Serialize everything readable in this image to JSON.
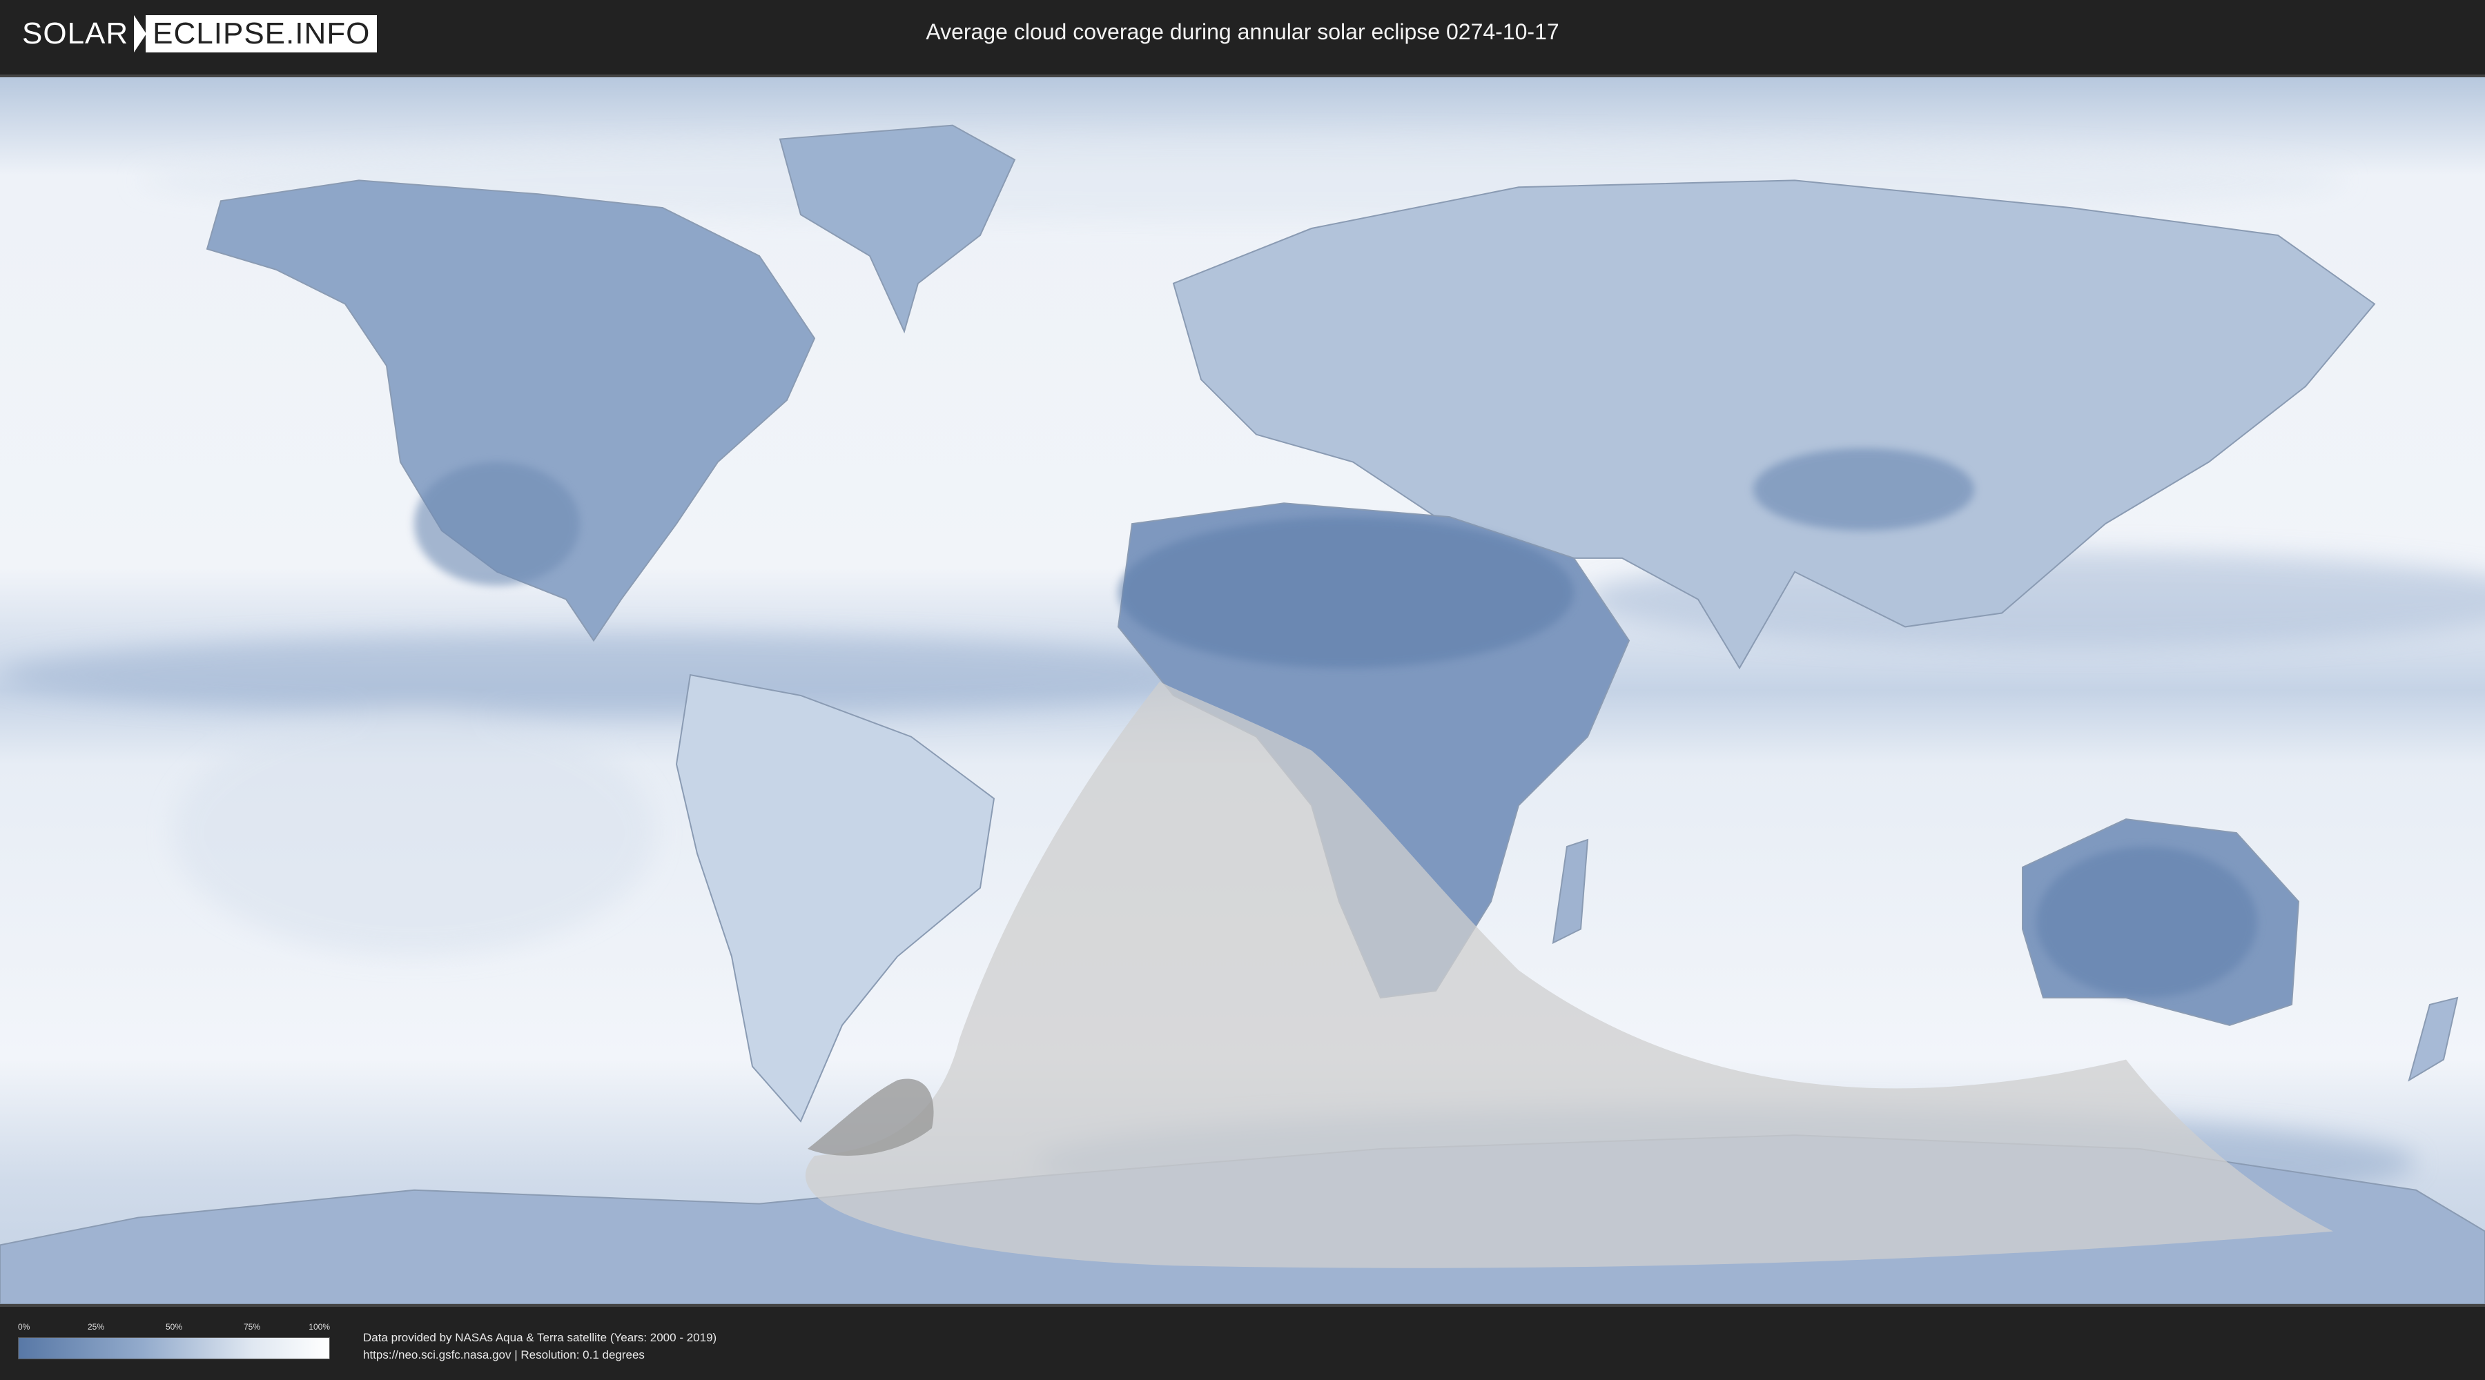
{
  "header": {
    "logo_left": "SOLAR",
    "logo_right": "ECLIPSE.INFO",
    "title": "Average cloud coverage during annular solar eclipse 0274-10-17"
  },
  "legend": {
    "ticks": [
      "0%",
      "25%",
      "50%",
      "75%",
      "100%"
    ],
    "colors": {
      "low": "#5878a6",
      "mid": "#93abcc",
      "high": "#ffffff"
    }
  },
  "credits": {
    "line1": "Data provided by NASAs Aqua & Terra satellite (Years: 2000 - 2019)",
    "line2": "https://neo.sci.gsfc.nasa.gov | Resolution: 0.1 degrees"
  },
  "colors": {
    "cloud_clear": "#5f7fab",
    "cloud_full": "#f4f7fb",
    "eclipse_overlay": "#cfcfcf",
    "bar_background": "#222222"
  }
}
